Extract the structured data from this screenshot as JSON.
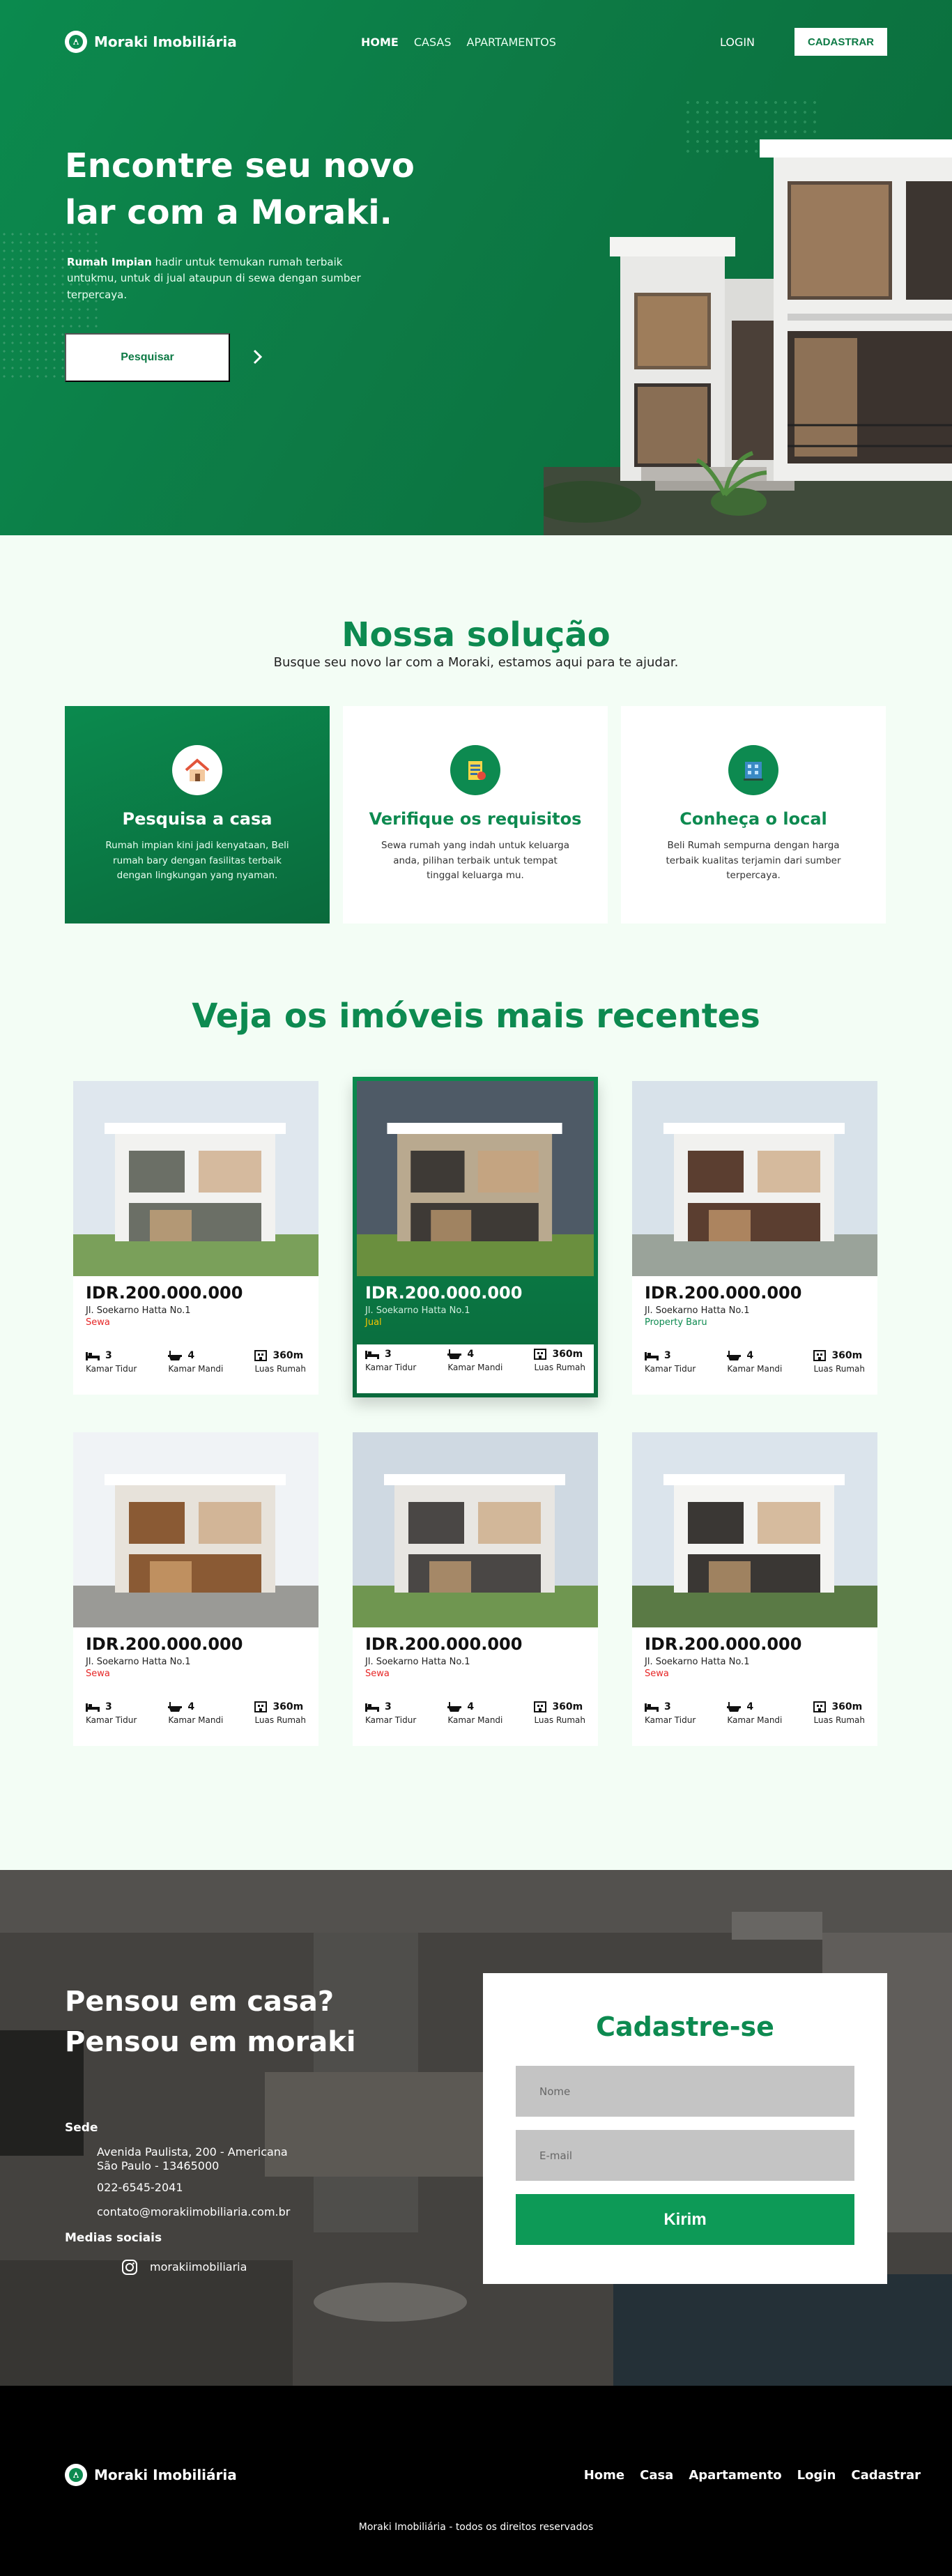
{
  "brand": {
    "name": "Moraki Imobiliária"
  },
  "nav": {
    "links": [
      "HOME",
      "CASAS",
      "APARTAMENTOS"
    ],
    "login": "LOGIN",
    "signup": "CADASTRAR"
  },
  "hero": {
    "title_line1": "Encontre seu novo",
    "title_line2": "lar com a Moraki.",
    "subtitle_bold": "Rumah Impian",
    "subtitle_rest": "hadir untuk temukan rumah terbaik untukmu, untuk di jual ataupun di sewa dengan sumber terpercaya.",
    "button": "Pesquisar"
  },
  "solution": {
    "title": "Nossa solução",
    "subtitle": "Busque seu novo lar com a Moraki, estamos aqui para te ajudar.",
    "cards": [
      {
        "title": "Pesquisa a casa",
        "text": "Rumah impian kini jadi kenyataan, Beli rumah bary dengan fasilitas terbaik dengan lingkungan yang nyaman.",
        "icon": "house-icon"
      },
      {
        "title": "Verifique os requisitos",
        "text": "Sewa rumah yang indah untuk keluarga anda, pilihan terbaik untuk tempat tinggal keluarga mu.",
        "icon": "checklist-icon"
      },
      {
        "title": "Conheça o local",
        "text": "Beli Rumah sempurna dengan harga terbaik kualitas terjamin dari sumber terpercaya.",
        "icon": "building-icon"
      }
    ]
  },
  "listings": {
    "title": "Veja os imóveis mais recentes",
    "feature_labels": {
      "beds": "Kamar Tidur",
      "baths": "Kamar Mandi",
      "area": "Luas Rumah"
    },
    "items": [
      {
        "price": "IDR.200.000.000",
        "address": "Jl. Soekarno Hatta No.1",
        "tag": "Sewa",
        "beds": "3",
        "baths": "4",
        "area": "360m"
      },
      {
        "price": "IDR.200.000.000",
        "address": "Jl. Soekarno Hatta No.1",
        "tag": "Jual",
        "beds": "3",
        "baths": "4",
        "area": "360m"
      },
      {
        "price": "IDR.200.000.000",
        "address": "Jl. Soekarno Hatta No.1",
        "tag": "Property Baru",
        "beds": "3",
        "baths": "4",
        "area": "360m"
      },
      {
        "price": "IDR.200.000.000",
        "address": "Jl. Soekarno Hatta No.1",
        "tag": "Sewa",
        "beds": "3",
        "baths": "4",
        "area": "360m"
      },
      {
        "price": "IDR.200.000.000",
        "address": "Jl. Soekarno Hatta No.1",
        "tag": "Sewa",
        "beds": "3",
        "baths": "4",
        "area": "360m"
      },
      {
        "price": "IDR.200.000.000",
        "address": "Jl. Soekarno Hatta No.1",
        "tag": "Sewa",
        "beds": "3",
        "baths": "4",
        "area": "360m"
      }
    ]
  },
  "contact": {
    "title_line1": "Pensou em casa?",
    "title_line2": "Pensou em moraki",
    "hq_label": "Sede",
    "address_line1": "Avenida Paulista, 200 - Americana",
    "address_line2": "São Paulo - 13465000",
    "phone": "022-6545-2041",
    "email": "contato@morakiimobiliaria.com.br",
    "social_label": "Medias sociais",
    "instagram": "morakiimobiliaria"
  },
  "form": {
    "title": "Cadastre-se",
    "name_placeholder": "Nome",
    "email_placeholder": "E-mail",
    "submit": "Kirim"
  },
  "footer": {
    "links": [
      "Home",
      "Casa",
      "Apartamento",
      "Login",
      "Cadastrar"
    ],
    "copyright": "Moraki Imobiliária - todos os direitos reservados"
  },
  "colors": {
    "primary": "#0d8a50",
    "primary_dark": "#0a6a3c",
    "tag_red": "#e62525",
    "tag_yellow": "#f5c400"
  }
}
